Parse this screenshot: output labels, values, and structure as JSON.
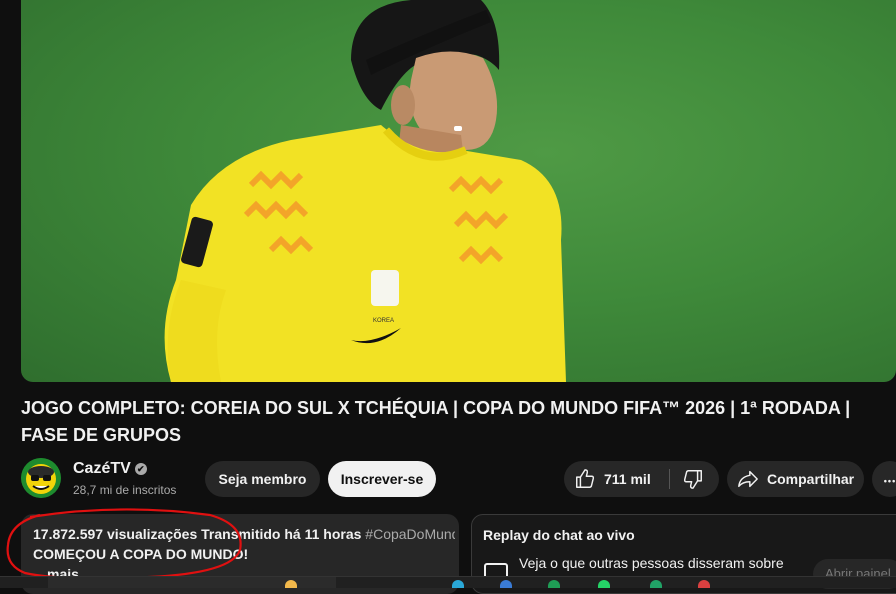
{
  "video": {
    "title": "JOGO COMPLETO: COREIA DO SUL X TCHÉQUIA | COPA DO MUNDO FIFA™ 2026 | 1ª RODADA | FASE DE GRUPOS"
  },
  "channel": {
    "name": "CazéTV",
    "verified_mark": "✔",
    "subscribers": "28,7 mi de inscritos"
  },
  "actions": {
    "join_label": "Seja membro",
    "subscribe_label": "Inscrever-se",
    "like_count": "711 mil",
    "share_label": "Compartilhar",
    "more_label": "•••"
  },
  "description": {
    "views_line": "17.872.597 visualizações  Transmitido há 11 horas",
    "hashtag": "#CopaDoMundo",
    "text": "COMEÇOU A COPA DO MUNDO!",
    "more_label": "mais"
  },
  "live_chat": {
    "title": "Replay do chat ao vivo",
    "subtitle": "Veja o que outras pessoas disseram sobre",
    "open_label": "Abrir painel"
  },
  "player": {
    "jersey_text": "KOREA"
  },
  "colors": {
    "background": "#0f0f0f",
    "pill": "#272727",
    "subscribe_bg": "#f1f1f1",
    "annotation": "#e01010",
    "pitch": "#3f8a3a",
    "jersey": "#f2e224"
  },
  "icons": [
    "thumbs-up-icon",
    "thumbs-down-icon",
    "share-arrow-icon",
    "chat-icon",
    "verified-icon"
  ]
}
